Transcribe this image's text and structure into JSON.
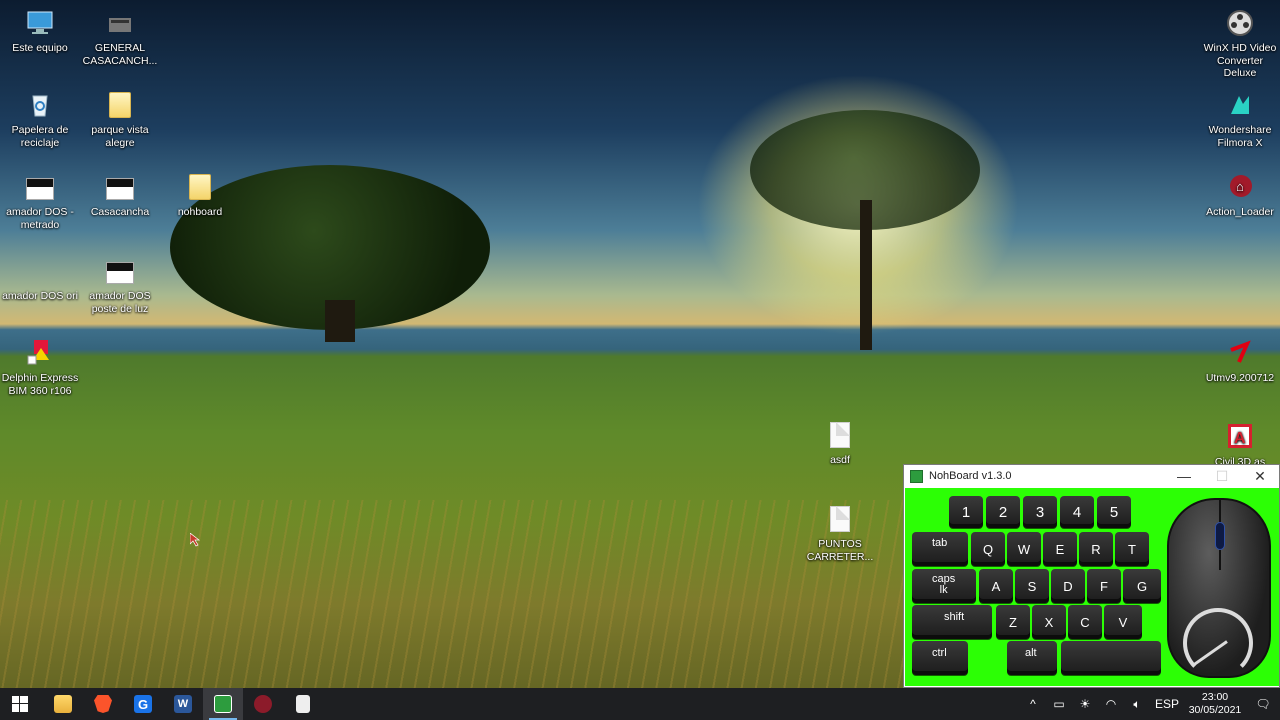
{
  "desktop": {
    "icons_left": [
      {
        "label": "Este equipo"
      },
      {
        "label": "GENERAL CASACANCH..."
      },
      {
        "label": "Papelera de reciclaje"
      },
      {
        "label": "parque vista alegre"
      },
      {
        "label": "amador DOS - metrado"
      },
      {
        "label": "Casacancha"
      },
      {
        "label": "nohboard"
      },
      {
        "label": "amador DOS ori"
      },
      {
        "label": "amador DOS poste de luz"
      },
      {
        "label": "Delphin Express BIM 360 r106"
      }
    ],
    "icons_middle": [
      {
        "label": "asdf"
      },
      {
        "label": "PUNTOS CARRETER..."
      }
    ],
    "icons_right": [
      {
        "label": "WinX HD Video Converter Deluxe"
      },
      {
        "label": "Wondershare Filmora X"
      },
      {
        "label": "Action_Loader"
      },
      {
        "label": "Utmv9.200712"
      },
      {
        "label": "Civil 3D as"
      }
    ]
  },
  "window": {
    "title": "NohBoard v1.3.0",
    "minimize_glyph": "—",
    "maximize_glyph": "☐",
    "close_glyph": "✕",
    "keys": [
      "1",
      "2",
      "3",
      "4",
      "5",
      "tab",
      "Q",
      "W",
      "E",
      "R",
      "T",
      "caps lk",
      "A",
      "S",
      "D",
      "F",
      "G",
      "shift",
      "Z",
      "X",
      "C",
      "V",
      "ctrl",
      "alt",
      ""
    ],
    "background_color": "#2cff05"
  },
  "taskbar": {
    "apps": [
      "start-icon",
      "file-explorer-icon",
      "brave-icon",
      "google-icon",
      "word-icon",
      "nohboard-icon",
      "rufus-icon",
      "notepad-icon"
    ],
    "tray": {
      "chevron": "^",
      "language": "ESP",
      "time": "23:00",
      "date": "30/05/2021"
    }
  }
}
